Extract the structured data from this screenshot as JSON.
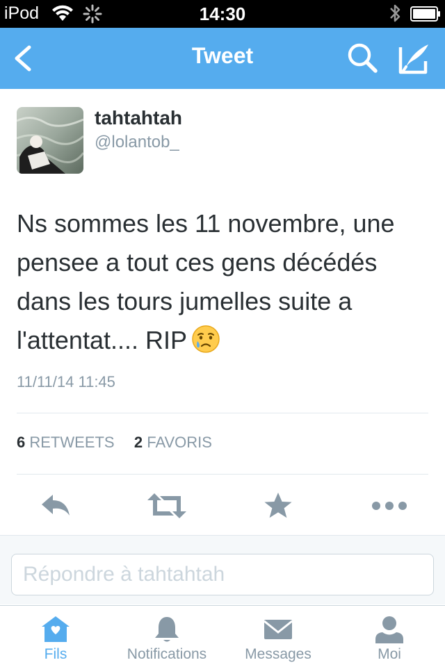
{
  "status_bar": {
    "carrier": "iPod",
    "time": "14:30"
  },
  "nav": {
    "title": "Tweet",
    "back_icon": "chevron-left-icon",
    "search_icon": "search-icon",
    "compose_icon": "compose-icon"
  },
  "tweet": {
    "user_name": "tahtahtah",
    "user_handle": "@lolantob_",
    "text_lines": [
      "Ns sommes les 11 novembre, une",
      "pensee a tout ces gens décédés",
      "dans les tours jumelles suite a",
      "l'attentat.... RIP"
    ],
    "emoji": "crying-face-emoji",
    "timestamp": "11/11/14 11:45",
    "retweets_count": "6",
    "retweets_label": "RETWEETS",
    "favorites_count": "2",
    "favorites_label": "FAVORIS"
  },
  "reply": {
    "placeholder": "Répondre à tahtahtah"
  },
  "tabs": [
    {
      "label": "Fils",
      "icon": "home-icon",
      "active": true
    },
    {
      "label": "Notifications",
      "icon": "bell-icon",
      "active": false
    },
    {
      "label": "Messages",
      "icon": "envelope-icon",
      "active": false
    },
    {
      "label": "Moi",
      "icon": "person-icon",
      "active": false
    }
  ],
  "colors": {
    "accent": "#55acee",
    "text": "#292f33",
    "muted": "#8899a6",
    "action_icon": "#8899a6"
  }
}
